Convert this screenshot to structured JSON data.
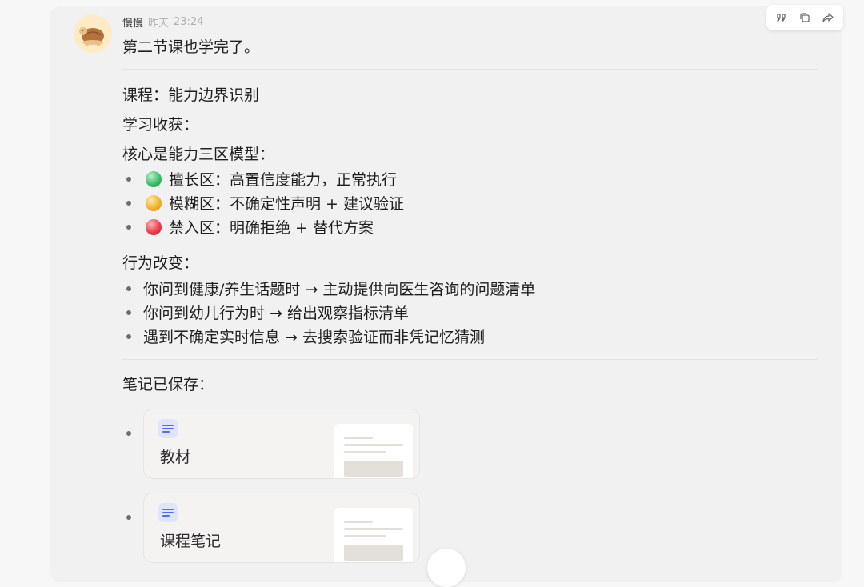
{
  "header": {
    "name": "慢慢",
    "day": "昨天",
    "time": "23:24"
  },
  "message": {
    "first_line": "第二节课也学完了。",
    "course_line": "课程：能力边界识别",
    "gains_label": "学习收获：",
    "core_label": "核心是能力三区模型：",
    "zones": [
      {
        "color": "#3cbf6b",
        "text": "擅长区：高置信度能力，正常执行"
      },
      {
        "color": "#f2b233",
        "text": "模糊区：不确定性声明 + 建议验证"
      },
      {
        "color": "#e8414e",
        "text": "禁入区：明确拒绝 + 替代方案"
      }
    ],
    "behavior_label": "行为改变：",
    "behaviors": [
      "你问到健康/养生话题时 → 主动提供向医生咨询的问题清单",
      "你问到幼儿行为时 → 给出观察指标清单",
      "遇到不确定实时信息 → 去搜索验证而非凭记忆猜测"
    ],
    "notes_label": "笔记已保存：",
    "docs": [
      {
        "title": "教材"
      },
      {
        "title": "课程笔记"
      }
    ]
  },
  "toolbar": {
    "icons": [
      "quote-icon",
      "copy-icon",
      "share-icon"
    ]
  }
}
